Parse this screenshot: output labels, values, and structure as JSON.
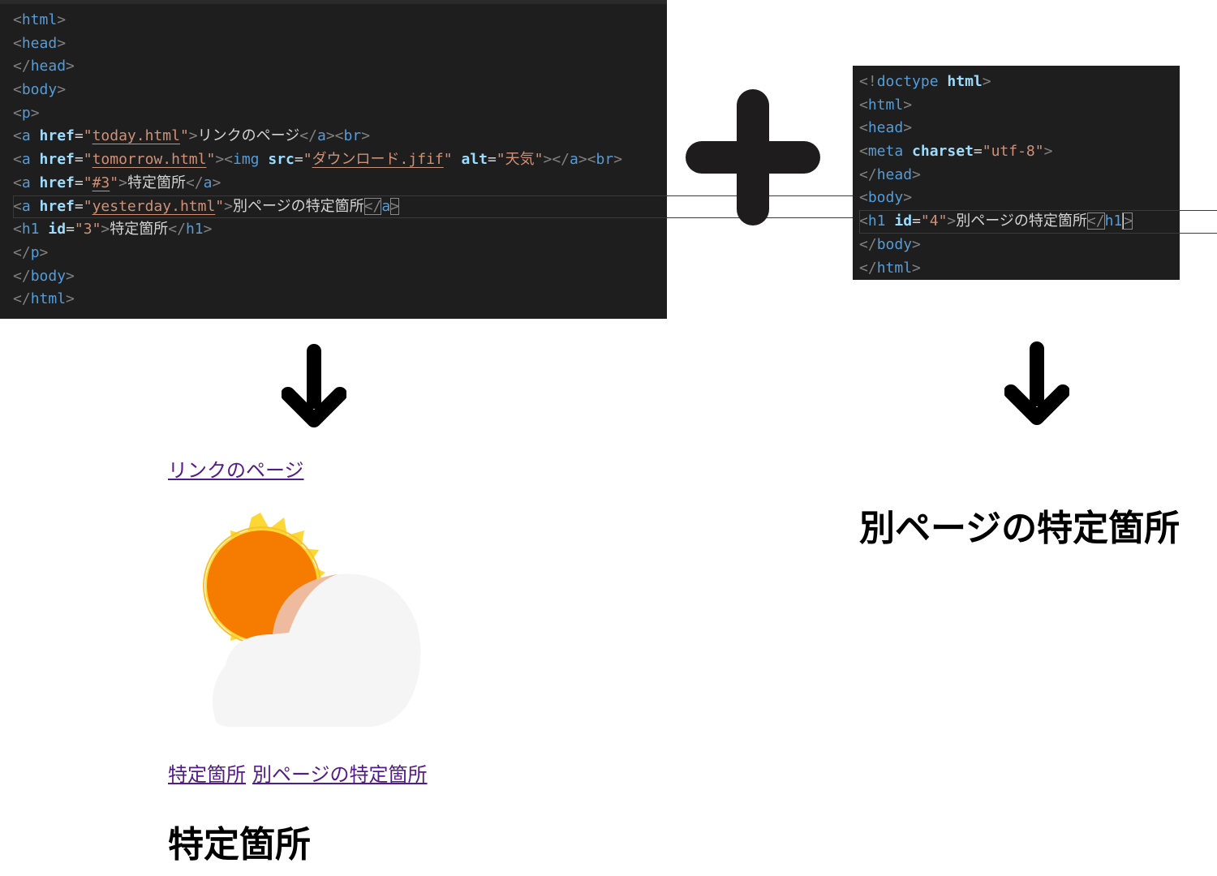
{
  "left_editor": {
    "lines": [
      {
        "parts": [
          {
            "c": "br",
            "t": "<"
          },
          {
            "c": "tag",
            "t": "html"
          },
          {
            "c": "br",
            "t": ">"
          }
        ]
      },
      {
        "parts": [
          {
            "c": "br",
            "t": "<"
          },
          {
            "c": "tag",
            "t": "head"
          },
          {
            "c": "br",
            "t": ">"
          }
        ]
      },
      {
        "parts": [
          {
            "c": "br",
            "t": "</"
          },
          {
            "c": "tag",
            "t": "head"
          },
          {
            "c": "br",
            "t": ">"
          }
        ]
      },
      {
        "parts": [
          {
            "c": "br",
            "t": "<"
          },
          {
            "c": "tag",
            "t": "body"
          },
          {
            "c": "br",
            "t": ">"
          }
        ]
      },
      {
        "parts": [
          {
            "c": "br",
            "t": "<"
          },
          {
            "c": "tag",
            "t": "p"
          },
          {
            "c": "br",
            "t": ">"
          }
        ]
      },
      {
        "parts": [
          {
            "c": "br",
            "t": "<"
          },
          {
            "c": "tag",
            "t": "a"
          },
          {
            "c": "eq",
            "t": " "
          },
          {
            "c": "attr",
            "t": "href"
          },
          {
            "c": "eq",
            "t": "="
          },
          {
            "c": "str",
            "t": "\""
          },
          {
            "c": "str link",
            "t": "today.html"
          },
          {
            "c": "str",
            "t": "\""
          },
          {
            "c": "br",
            "t": ">"
          },
          {
            "c": "text",
            "t": "リンクのページ"
          },
          {
            "c": "br",
            "t": "</"
          },
          {
            "c": "tag",
            "t": "a"
          },
          {
            "c": "br",
            "t": "><"
          },
          {
            "c": "tag",
            "t": "br"
          },
          {
            "c": "br",
            "t": ">"
          }
        ]
      },
      {
        "parts": [
          {
            "c": "br",
            "t": "<"
          },
          {
            "c": "tag",
            "t": "a"
          },
          {
            "c": "eq",
            "t": " "
          },
          {
            "c": "attr",
            "t": "href"
          },
          {
            "c": "eq",
            "t": "="
          },
          {
            "c": "str",
            "t": "\""
          },
          {
            "c": "str link",
            "t": "tomorrow.html"
          },
          {
            "c": "str",
            "t": "\""
          },
          {
            "c": "br",
            "t": "><"
          },
          {
            "c": "tag",
            "t": "img"
          },
          {
            "c": "eq",
            "t": " "
          },
          {
            "c": "attr",
            "t": "src"
          },
          {
            "c": "eq",
            "t": "="
          },
          {
            "c": "str",
            "t": "\""
          },
          {
            "c": "str link",
            "t": "ダウンロード.jfif"
          },
          {
            "c": "str",
            "t": "\""
          },
          {
            "c": "eq",
            "t": " "
          },
          {
            "c": "attr",
            "t": "alt"
          },
          {
            "c": "eq",
            "t": "="
          },
          {
            "c": "str",
            "t": "\"天気\""
          },
          {
            "c": "br",
            "t": "></"
          },
          {
            "c": "tag",
            "t": "a"
          },
          {
            "c": "br",
            "t": "><"
          },
          {
            "c": "tag",
            "t": "br"
          },
          {
            "c": "br",
            "t": ">"
          }
        ]
      },
      {
        "parts": [
          {
            "c": "br",
            "t": "<"
          },
          {
            "c": "tag",
            "t": "a"
          },
          {
            "c": "eq",
            "t": " "
          },
          {
            "c": "attr",
            "t": "href"
          },
          {
            "c": "eq",
            "t": "="
          },
          {
            "c": "str",
            "t": "\""
          },
          {
            "c": "str link",
            "t": "#3"
          },
          {
            "c": "str",
            "t": "\""
          },
          {
            "c": "br",
            "t": ">"
          },
          {
            "c": "text",
            "t": "特定箇所"
          },
          {
            "c": "br",
            "t": "</"
          },
          {
            "c": "tag",
            "t": "a"
          },
          {
            "c": "br",
            "t": ">"
          }
        ]
      },
      {
        "current": true,
        "parts": [
          {
            "c": "br",
            "t": "<"
          },
          {
            "c": "tag",
            "t": "a"
          },
          {
            "c": "eq",
            "t": " "
          },
          {
            "c": "attr",
            "t": "href"
          },
          {
            "c": "eq",
            "t": "="
          },
          {
            "c": "str",
            "t": "\""
          },
          {
            "c": "str link",
            "t": "yesterday.html"
          },
          {
            "c": "str",
            "t": "\""
          },
          {
            "c": "br",
            "t": ">"
          },
          {
            "c": "text",
            "t": "別ページの特定箇所"
          },
          {
            "c": "br match",
            "t": "</"
          },
          {
            "c": "tag",
            "t": "a"
          },
          {
            "c": "br match",
            "t": ">"
          }
        ]
      },
      {
        "parts": [
          {
            "c": "br",
            "t": "<"
          },
          {
            "c": "tag",
            "t": "h1"
          },
          {
            "c": "eq",
            "t": " "
          },
          {
            "c": "attr",
            "t": "id"
          },
          {
            "c": "eq",
            "t": "="
          },
          {
            "c": "str",
            "t": "\"3\""
          },
          {
            "c": "br",
            "t": ">"
          },
          {
            "c": "text",
            "t": "特定箇所"
          },
          {
            "c": "br",
            "t": "</"
          },
          {
            "c": "tag",
            "t": "h1"
          },
          {
            "c": "br",
            "t": ">"
          }
        ]
      },
      {
        "parts": [
          {
            "c": "br",
            "t": "</"
          },
          {
            "c": "tag",
            "t": "p"
          },
          {
            "c": "br",
            "t": ">"
          }
        ]
      },
      {
        "parts": [
          {
            "c": "br",
            "t": "</"
          },
          {
            "c": "tag",
            "t": "body"
          },
          {
            "c": "br",
            "t": ">"
          }
        ]
      },
      {
        "parts": [
          {
            "c": "br",
            "t": "</"
          },
          {
            "c": "tag",
            "t": "html"
          },
          {
            "c": "br",
            "t": ">"
          }
        ]
      }
    ]
  },
  "right_editor": {
    "lines": [
      {
        "parts": [
          {
            "c": "br",
            "t": "<!"
          },
          {
            "c": "tag",
            "t": "doctype"
          },
          {
            "c": "eq",
            "t": " "
          },
          {
            "c": "attr",
            "t": "html"
          },
          {
            "c": "br",
            "t": ">"
          }
        ]
      },
      {
        "parts": [
          {
            "c": "br",
            "t": "<"
          },
          {
            "c": "tag",
            "t": "html"
          },
          {
            "c": "br",
            "t": ">"
          }
        ]
      },
      {
        "parts": [
          {
            "c": "br",
            "t": "<"
          },
          {
            "c": "tag",
            "t": "head"
          },
          {
            "c": "br",
            "t": ">"
          }
        ]
      },
      {
        "parts": [
          {
            "c": "br",
            "t": "<"
          },
          {
            "c": "tag",
            "t": "meta"
          },
          {
            "c": "eq",
            "t": " "
          },
          {
            "c": "attr",
            "t": "charset"
          },
          {
            "c": "eq",
            "t": "="
          },
          {
            "c": "str",
            "t": "\"utf-8\""
          },
          {
            "c": "br",
            "t": ">"
          }
        ]
      },
      {
        "parts": [
          {
            "c": "br",
            "t": "</"
          },
          {
            "c": "tag",
            "t": "head"
          },
          {
            "c": "br",
            "t": ">"
          }
        ]
      },
      {
        "parts": [
          {
            "c": "br",
            "t": "<"
          },
          {
            "c": "tag",
            "t": "body"
          },
          {
            "c": "br",
            "t": ">"
          }
        ]
      },
      {
        "current": true,
        "parts": [
          {
            "c": "br",
            "t": "<"
          },
          {
            "c": "tag",
            "t": "h1"
          },
          {
            "c": "eq",
            "t": " "
          },
          {
            "c": "attr",
            "t": "id"
          },
          {
            "c": "eq",
            "t": "="
          },
          {
            "c": "str",
            "t": "\"4\""
          },
          {
            "c": "br",
            "t": ">"
          },
          {
            "c": "text",
            "t": "別ページの特定箇所"
          },
          {
            "c": "br match",
            "t": "</"
          },
          {
            "c": "tag",
            "t": "h1"
          },
          {
            "c": "br match cursor",
            "t": ">"
          }
        ]
      },
      {
        "parts": [
          {
            "c": "br",
            "t": "</"
          },
          {
            "c": "tag",
            "t": "body"
          },
          {
            "c": "br",
            "t": ">"
          }
        ]
      },
      {
        "parts": [
          {
            "c": "br",
            "t": "</"
          },
          {
            "c": "tag",
            "t": "html"
          },
          {
            "c": "br",
            "t": ">"
          }
        ]
      }
    ]
  },
  "preview_left": {
    "link_today": "リンクのページ",
    "link_anchor": "特定箇所",
    "link_yesterday": "別ページの特定箇所",
    "heading": "特定箇所"
  },
  "preview_right": {
    "heading": "別ページの特定箇所"
  },
  "colors": {
    "editor_bg": "#1e1e1e",
    "tag": "#569cd6",
    "attr": "#9cdcfe",
    "string": "#ce9178",
    "visited_link": "#551a8b",
    "sun_outer": "#fdd835",
    "sun_inner": "#f57c00",
    "cloud": "#f5f5f5"
  },
  "icons": [
    "plus-icon",
    "down-arrow-icon",
    "weather-sun-cloud-icon"
  ]
}
